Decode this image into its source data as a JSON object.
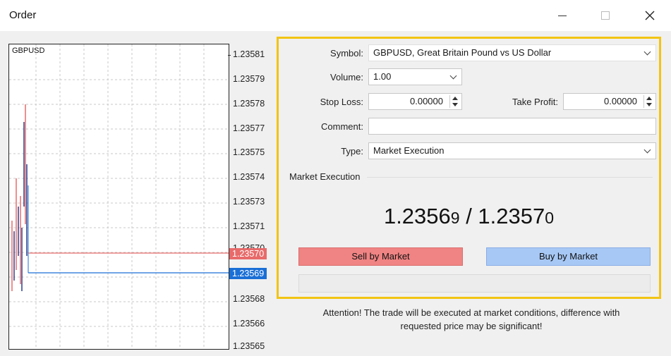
{
  "window": {
    "title": "Order"
  },
  "chart": {
    "symbol": "GBPUSD",
    "price_ticks": [
      "1.23581",
      "1.23579",
      "1.23578",
      "1.23577",
      "1.23575",
      "1.23574",
      "1.23573",
      "1.23571",
      "1.23570",
      "1.23569",
      "1.23568",
      "1.23566",
      "1.23565"
    ],
    "ask_tag": "1.23570",
    "bid_tag": "1.23569",
    "ask_color": "#e86a6a",
    "bid_color": "#1a6fd6"
  },
  "order": {
    "symbol_label": "Symbol:",
    "symbol_value": "GBPUSD, Great Britain Pound vs US Dollar",
    "volume_label": "Volume:",
    "volume_value": "1.00",
    "stop_loss_label": "Stop Loss:",
    "stop_loss_value": "0.00000",
    "take_profit_label": "Take Profit:",
    "take_profit_value": "0.00000",
    "comment_label": "Comment:",
    "comment_value": "",
    "type_label": "Type:",
    "type_value": "Market Execution",
    "group_title": "Market Execution",
    "bid_main": "1.2356",
    "bid_last": "9",
    "separator": " / ",
    "ask_main": "1.2357",
    "ask_last": "0",
    "sell_label": "Sell by Market",
    "buy_label": "Buy by Market",
    "highlight_color": "#f2c413"
  },
  "attention": {
    "line1": "Attention! The trade will be executed at market conditions, difference with",
    "line2": "requested price may be significant!"
  }
}
